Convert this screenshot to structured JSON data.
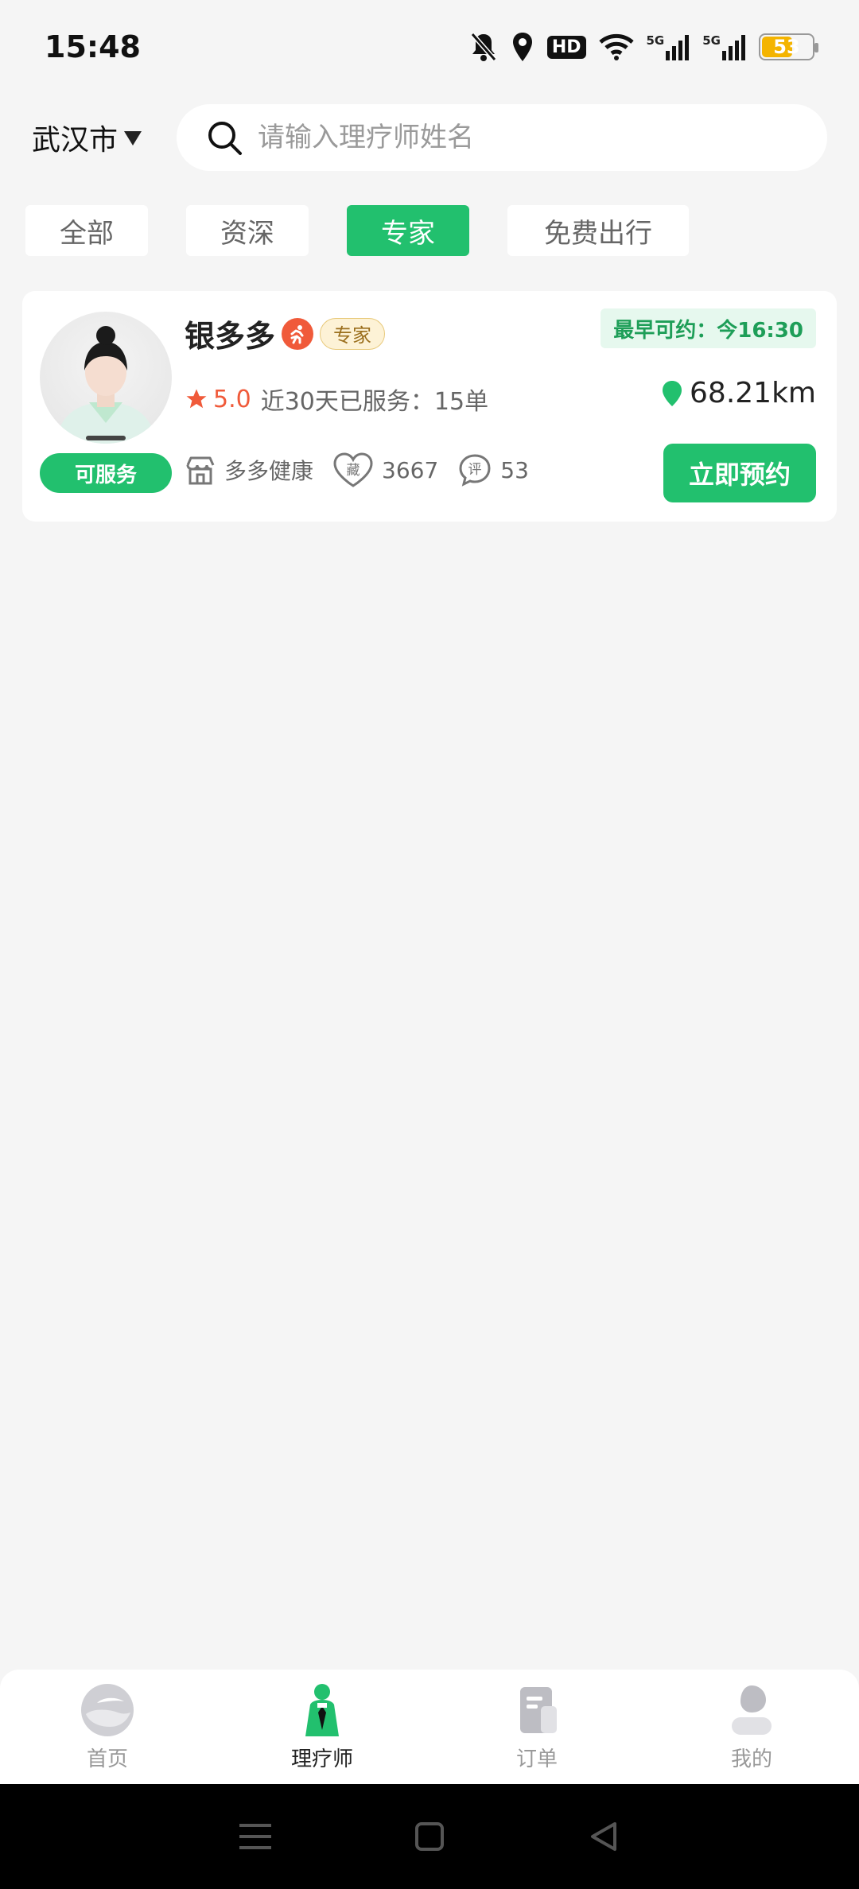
{
  "status_bar": {
    "time": "15:48",
    "battery": "53",
    "hd": "HD",
    "net1": "5G",
    "net2": "5G"
  },
  "header": {
    "city": "武汉市",
    "search_placeholder": "请输入理疗师姓名"
  },
  "filter_tabs": [
    {
      "label": "全部",
      "active": false
    },
    {
      "label": "资深",
      "active": false
    },
    {
      "label": "专家",
      "active": true
    },
    {
      "label": "免费出行",
      "active": false
    }
  ],
  "therapist": {
    "name": "银多多",
    "level_tag": "专家",
    "earliest": "最早可约：今16:30",
    "rating": "5.0",
    "served": "近30天已服务：15单",
    "distance": "68.21km",
    "status": "可服务",
    "shop": "多多健康",
    "favorites_icon_char": "藏",
    "favorites": "3667",
    "reviews_icon_char": "评",
    "reviews": "53",
    "book_label": "立即预约"
  },
  "bottom_nav": [
    {
      "label": "首页",
      "icon": "home-icon",
      "active": false
    },
    {
      "label": "理疗师",
      "icon": "therapist-icon",
      "active": true
    },
    {
      "label": "订单",
      "icon": "order-icon",
      "active": false
    },
    {
      "label": "我的",
      "icon": "profile-icon",
      "active": false
    }
  ],
  "colors": {
    "primary": "#22c06e",
    "accent_red": "#f05a3a",
    "background": "#f5f5f5"
  }
}
